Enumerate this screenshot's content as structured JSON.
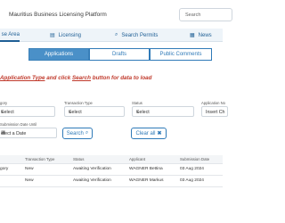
{
  "header": {
    "title": "Mauritius Business Licensing Platform",
    "search_label": "Search"
  },
  "nav": {
    "items": [
      {
        "label": "se Area",
        "icon": "home-icon",
        "active": true
      },
      {
        "label": "Licensing",
        "icon": "document-icon",
        "active": false
      },
      {
        "label": "Search Permits",
        "icon": "search-icon",
        "active": false
      },
      {
        "label": "News",
        "icon": "newspaper-icon",
        "active": false
      }
    ]
  },
  "tabs": [
    {
      "label": "Applications",
      "active": true
    },
    {
      "label": "Drafts",
      "active": false
    },
    {
      "label": "Public Comments",
      "active": false
    }
  ],
  "instruction": {
    "part1": "Application Type",
    "part2": " and click ",
    "part3": "Search",
    "part4": " button for data to load"
  },
  "filters": {
    "category_label": "gory",
    "category_value": "Select",
    "transaction_type_label": "Transaction Type",
    "transaction_type_value": "Select",
    "status_label": "Status",
    "status_value": "Select",
    "application_no_label": "Application No",
    "application_no_placeholder": "Insert Ch",
    "submission_date_label": "Submission Date Until",
    "submission_date_placeholder": "elect a Date",
    "search_button": "Search",
    "clear_button": "Clear all"
  },
  "table": {
    "headers": [
      "Transaction Type",
      "Status",
      "Applicant",
      "Submission Date"
    ],
    "rows": [
      {
        "category": "gory",
        "type": "New",
        "status": "Awaiting Verification",
        "applicant": "WAGNER Bettina",
        "date": "03 Aug 2024"
      },
      {
        "category": "",
        "type": "New",
        "status": "Awaiting Verification",
        "applicant": "WAGNER Markus",
        "date": "03 Aug 2024"
      }
    ]
  },
  "colors": {
    "accent": "#2f7ab8",
    "active_tab": "#4a90c8",
    "instruction": "#c0392b"
  }
}
